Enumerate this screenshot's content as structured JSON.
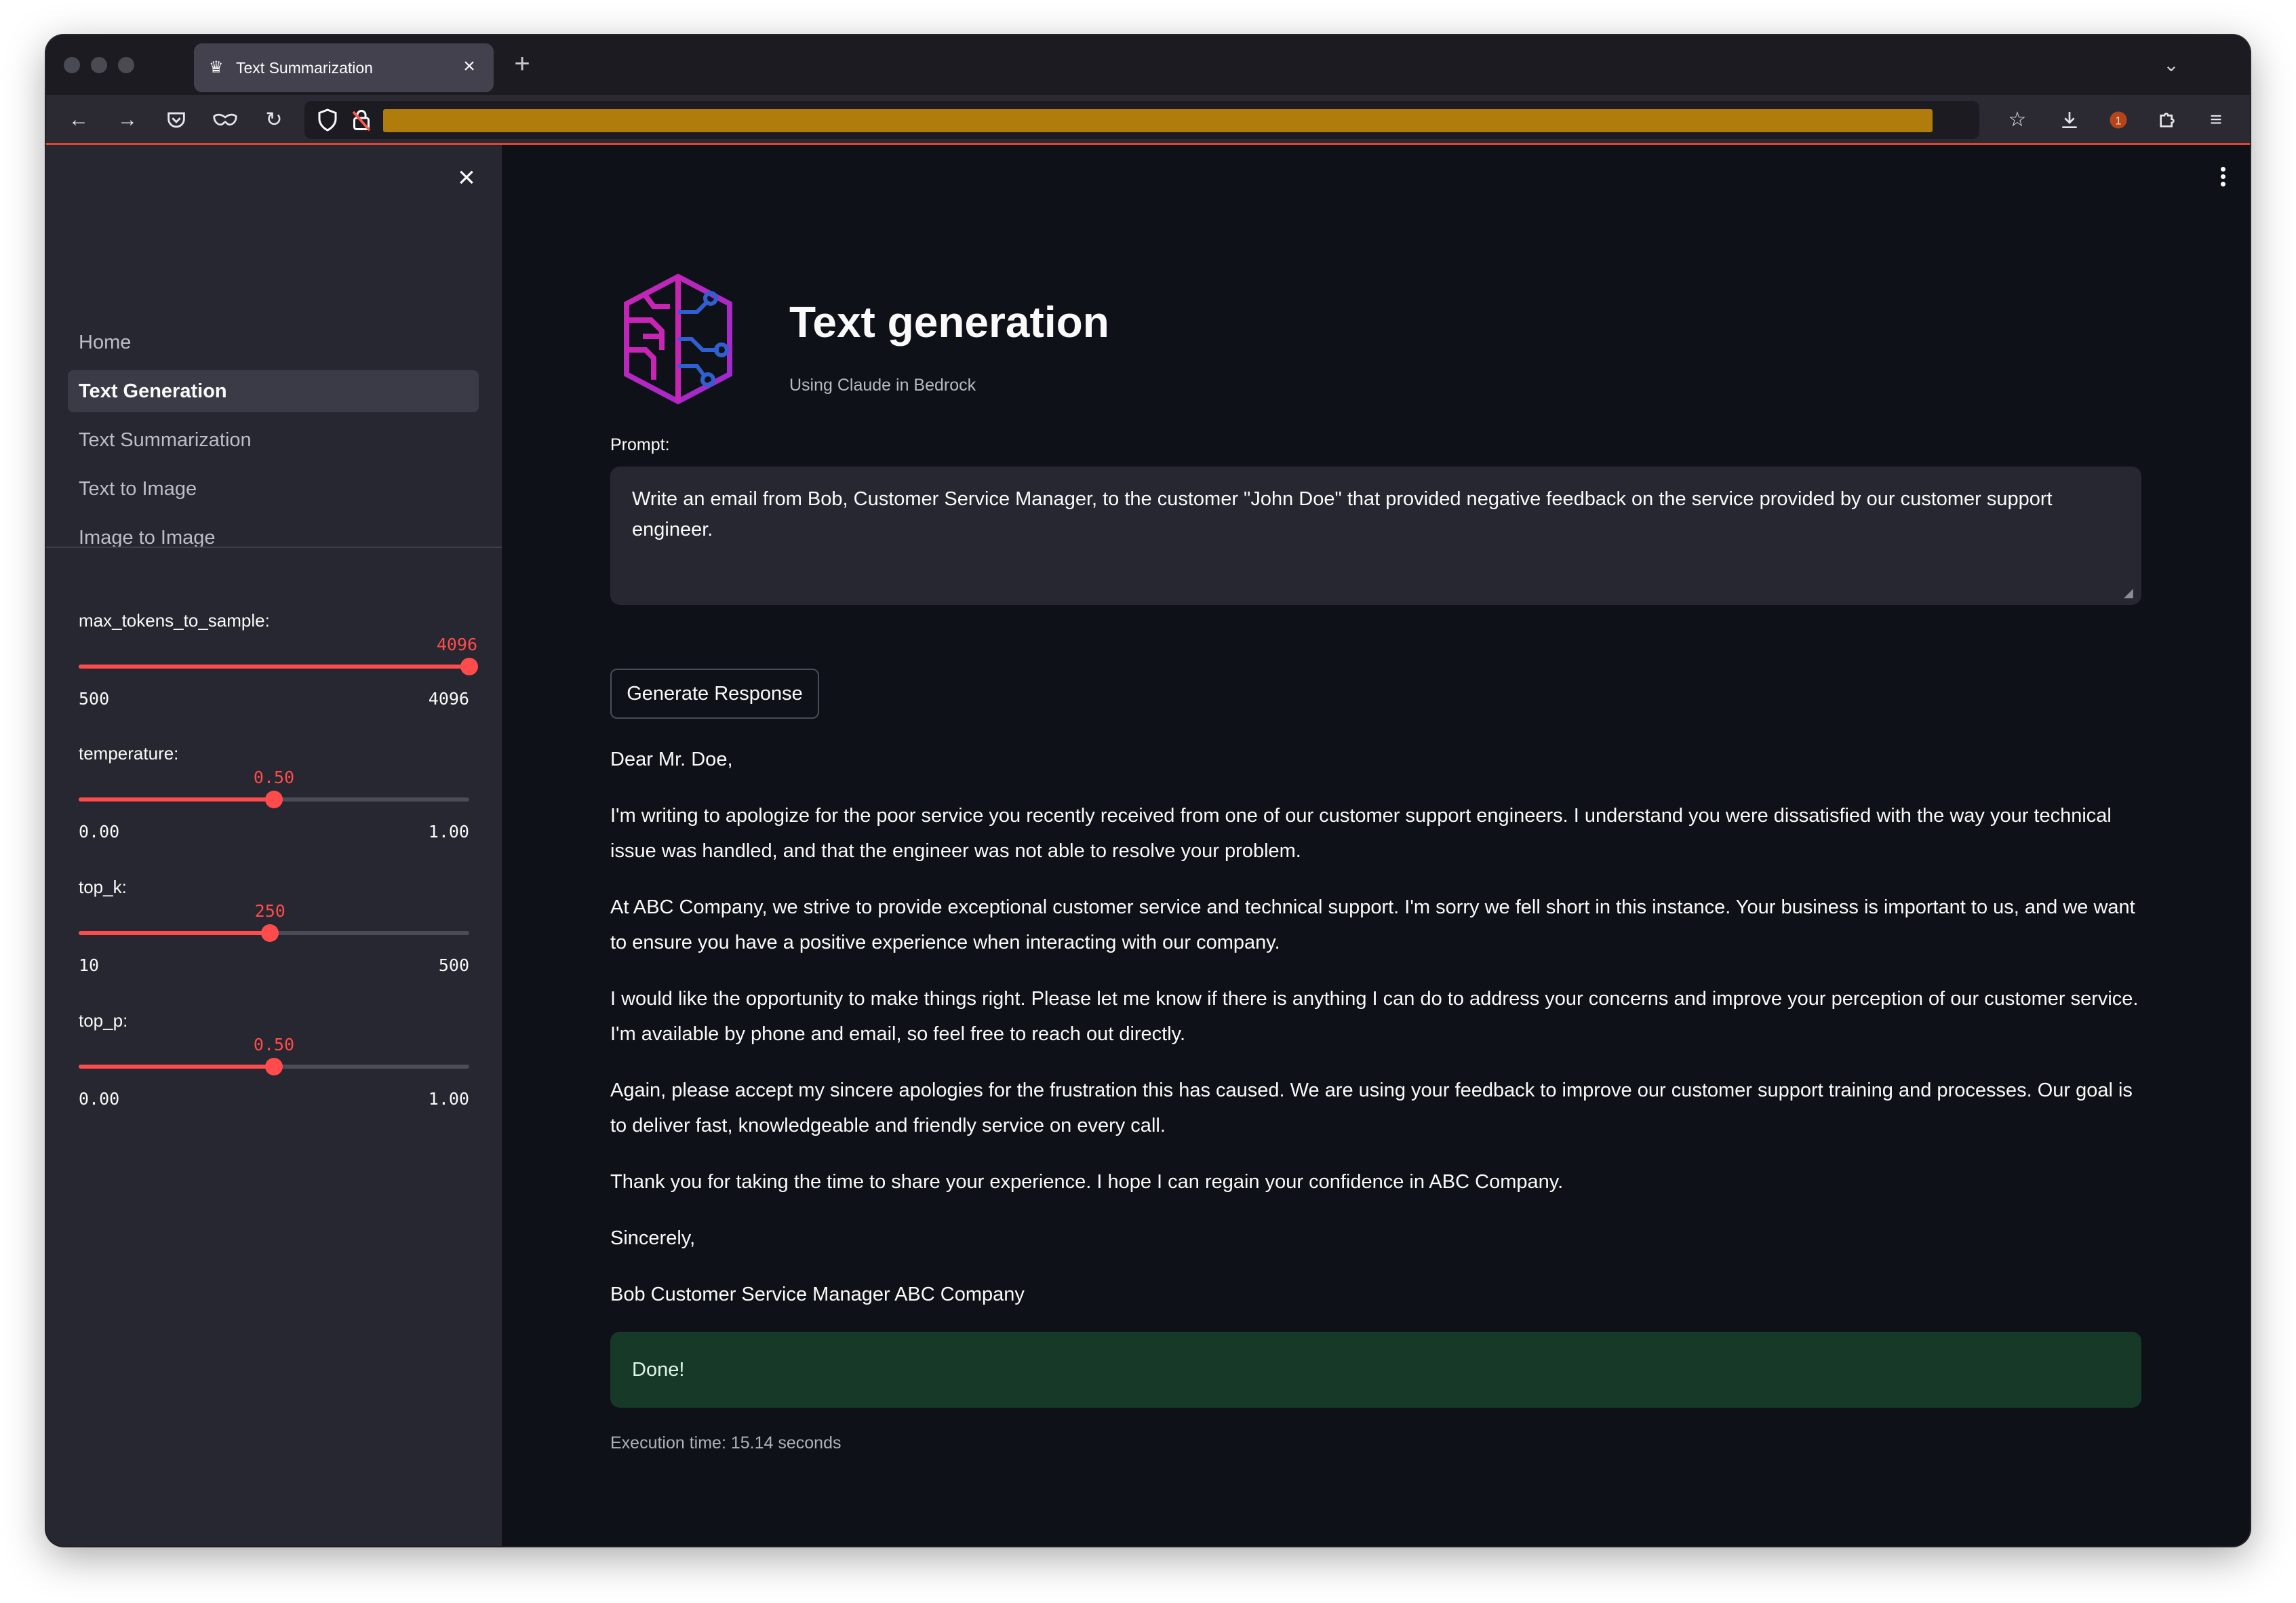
{
  "browser": {
    "tab_title": "Text Summarization",
    "new_tab_symbol": "+",
    "icons": {
      "back": "arrow-left-icon",
      "forward": "arrow-right-icon",
      "pocket": "pocket-icon",
      "private": "mask-icon",
      "reload": "reload-icon",
      "shield": "shield-icon",
      "lock": "lock-icon",
      "bookmark": "star-icon",
      "downloads": "download-icon",
      "extension": "extension-badge-icon",
      "extensions": "puzzle-icon",
      "menu": "hamburger-menu-icon"
    },
    "accent_color": "#e0432f"
  },
  "sidebar": {
    "close_symbol": "×",
    "nav": [
      {
        "label": "Home"
      },
      {
        "label": "Text Generation",
        "active": true
      },
      {
        "label": "Text Summarization"
      },
      {
        "label": "Text to Image"
      },
      {
        "label": "Image to Image"
      }
    ],
    "sliders": [
      {
        "label": "max_tokens_to_sample:",
        "value": "4096",
        "min": "500",
        "max": "4096",
        "fraction": 1.0
      },
      {
        "label": "temperature:",
        "value": "0.50",
        "min": "0.00",
        "max": "1.00",
        "fraction": 0.5
      },
      {
        "label": "top_k:",
        "value": "250",
        "min": "10",
        "max": "500",
        "fraction": 0.49
      },
      {
        "label": "top_p:",
        "value": "0.50",
        "min": "0.00",
        "max": "1.00",
        "fraction": 0.5
      }
    ],
    "slider_color": "#ff4b4b"
  },
  "main": {
    "title": "Text generation",
    "subtitle": "Using Claude in Bedrock",
    "prompt_label": "Prompt:",
    "prompt_value": "Write an email from Bob, Customer Service Manager, to the customer \"John Doe\" that provided negative feedback on the service provided by our customer support engineer.",
    "generate_button": "Generate Response",
    "response": [
      "Dear Mr. Doe,",
      "I'm writing to apologize for the poor service you recently received from one of our customer support engineers. I understand you were dissatisfied with the way your technical issue was handled, and that the engineer was not able to resolve your problem.",
      "At ABC Company, we strive to provide exceptional customer service and technical support. I'm sorry we fell short in this instance. Your business is important to us, and we want to ensure you have a positive experience when interacting with our company.",
      "I would like the opportunity to make things right. Please let me know if there is anything I can do to address your concerns and improve your perception of our customer service. I'm available by phone and email, so feel free to reach out directly.",
      "Again, please accept my sincere apologies for the frustration this has caused. We are using your feedback to improve our customer support training and processes. Our goal is to deliver fast, knowledgeable and friendly service on every call.",
      "Thank you for taking the time to share your experience. I hope I can regain your confidence in ABC Company.",
      "Sincerely,",
      "Bob Customer Service Manager ABC Company"
    ],
    "status_message": "Done!",
    "execution_time": "Execution time: 15.14 seconds",
    "logo_icon": "bedrock-brain-icon",
    "status_color": "#173928"
  }
}
